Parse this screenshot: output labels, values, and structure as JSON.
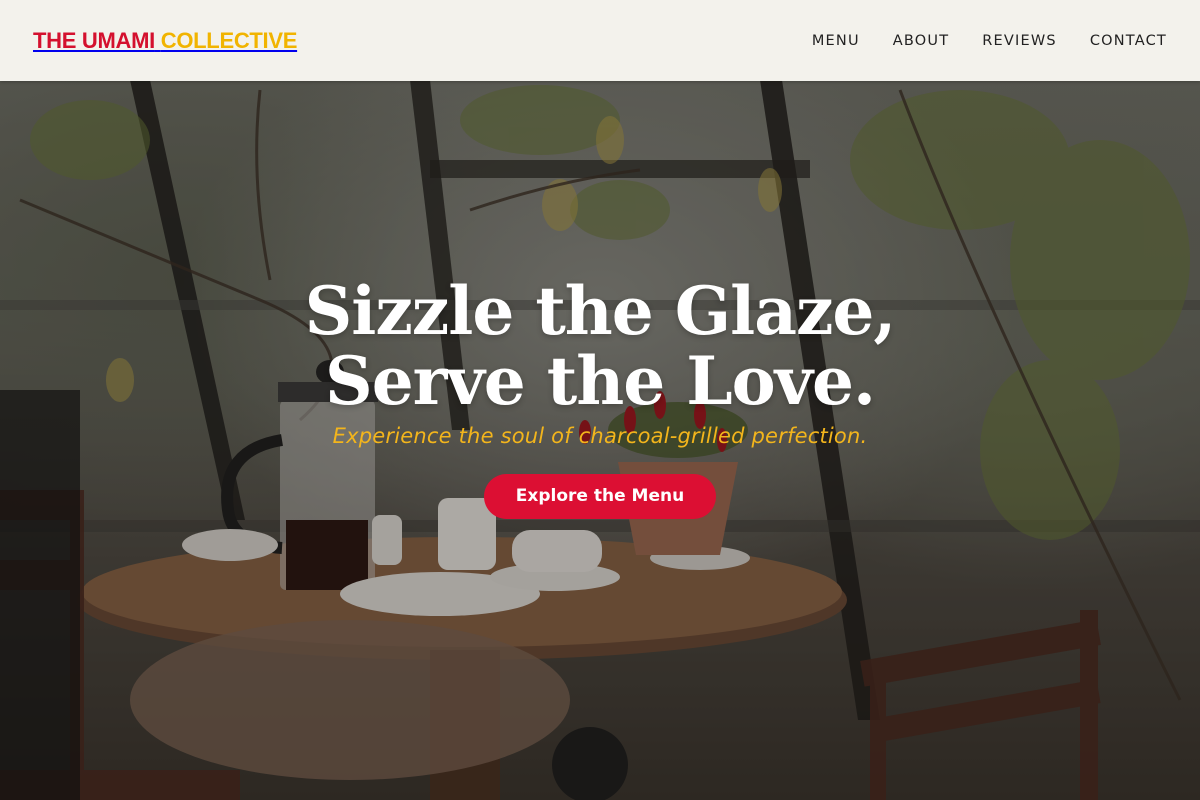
{
  "brand": {
    "name_part1": "THE UMAMI",
    "name_part2": "COLLECTIVE",
    "color_primary": "#d4102e",
    "color_secondary": "#f1b400"
  },
  "nav": {
    "items": [
      {
        "label": "MENU"
      },
      {
        "label": "ABOUT"
      },
      {
        "label": "REVIEWS"
      },
      {
        "label": "CONTACT"
      }
    ]
  },
  "hero": {
    "headline_line1": "Sizzle the Glaze,",
    "headline_line2": "Serve the Love.",
    "tagline": "Experience the soul of charcoal-grilled perfection.",
    "cta_label": "Explore the Menu",
    "cta_color": "#dc0f33",
    "tagline_color": "#f3b51c"
  }
}
